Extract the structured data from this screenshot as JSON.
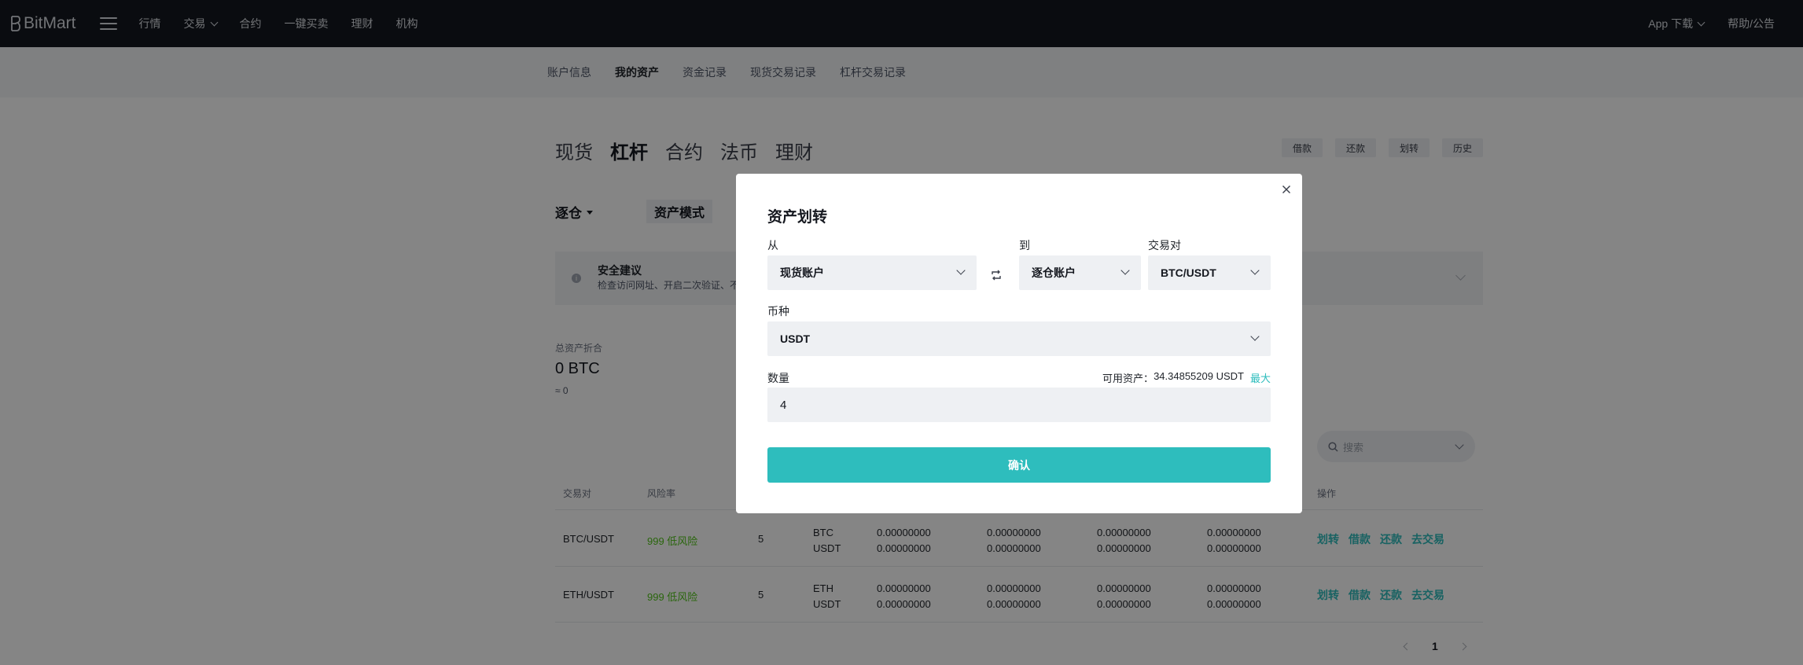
{
  "topnav": {
    "logo": "BitMart",
    "links": [
      "行情",
      "交易",
      "合约",
      "一键买卖",
      "理财",
      "机构"
    ],
    "right": [
      "App 下载",
      "帮助/公告"
    ]
  },
  "subnav": [
    "账户信息",
    "我的资产",
    "资金记录",
    "现货交易记录",
    "杠杆交易记录"
  ],
  "account_tabs": [
    "现货",
    "杠杆",
    "合约",
    "法币",
    "理财"
  ],
  "actions": [
    "借款",
    "还款",
    "划转",
    "历史"
  ],
  "mode": {
    "select": "逐仓",
    "badge": "资产模式"
  },
  "security": {
    "title": "安全建议",
    "desc": "检查访问网址、开启二次验证、不"
  },
  "total": {
    "label": "总资产折合",
    "value": "0 BTC",
    "fiat": "≈ 0"
  },
  "search": {
    "placeholder": "搜索"
  },
  "table": {
    "headers": {
      "pair": "交易对",
      "risk": "风险率",
      "ops": "操作"
    },
    "rows": [
      {
        "pair": "BTC/USDT",
        "risk": "999 低风险",
        "lev": "5",
        "coin1": "BTC",
        "coin2": "USDT",
        "a1": "0.00000000",
        "a2": "0.00000000",
        "b1": "0.00000000",
        "b2": "0.00000000",
        "c1": "0.00000000",
        "c2": "0.00000000",
        "d1": "0.00000000",
        "d2": "0.00000000"
      },
      {
        "pair": "ETH/USDT",
        "risk": "999 低风险",
        "lev": "5",
        "coin1": "ETH",
        "coin2": "USDT",
        "a1": "0.00000000",
        "a2": "0.00000000",
        "b1": "0.00000000",
        "b2": "0.00000000",
        "c1": "0.00000000",
        "c2": "0.00000000",
        "d1": "0.00000000",
        "d2": "0.00000000"
      }
    ],
    "ops": [
      "划转",
      "借款",
      "还款",
      "去交易"
    ]
  },
  "pager": {
    "current": "1"
  },
  "modal": {
    "title": "资产划转",
    "from_label": "从",
    "from_value": "现货账户",
    "to_label": "到",
    "to_value": "逐仓账户",
    "pair_label": "交易对",
    "pair_value": "BTC/USDT",
    "coin_label": "币种",
    "coin_value": "USDT",
    "qty_label": "数量",
    "available_label": "可用资产：",
    "available_value": "34.34855209 USDT",
    "max_label": "最大",
    "qty_value": "4",
    "confirm_label": "确认"
  },
  "colors": {
    "accent": "#2ebdbd",
    "nav_bg": "#15181f",
    "risk_low": "#52c41a"
  }
}
